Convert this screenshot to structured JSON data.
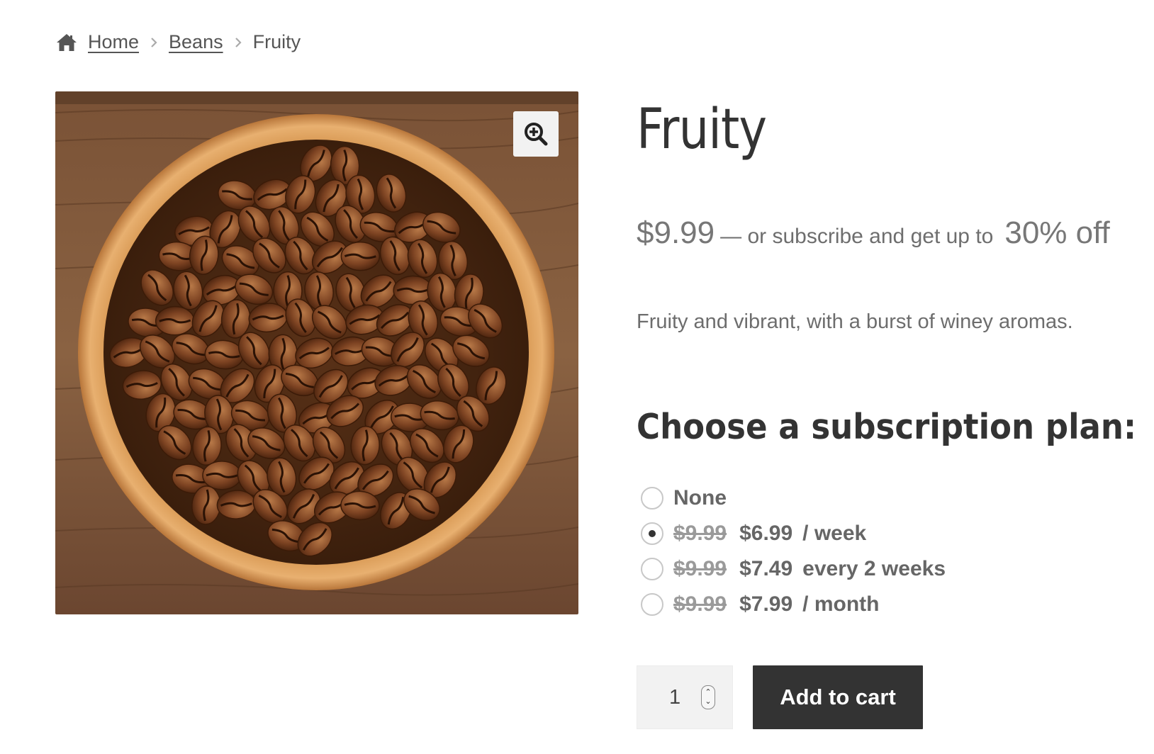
{
  "breadcrumb": {
    "items": [
      {
        "label": "Home"
      },
      {
        "label": "Beans"
      }
    ],
    "current": "Fruity"
  },
  "product": {
    "title": "Fruity",
    "price": "$9.99",
    "price_details": "— or subscribe and get up to",
    "discount": "30% off",
    "description": "Fruity and vibrant, with a burst of winey aromas."
  },
  "subscription": {
    "heading": "Choose a subscription plan:",
    "selected_index": 1,
    "options": [
      {
        "label": "None",
        "old_price": "",
        "new_price": "",
        "period": ""
      },
      {
        "label": "",
        "old_price": "$9.99",
        "new_price": "$6.99",
        "period": "/ week"
      },
      {
        "label": "",
        "old_price": "$9.99",
        "new_price": "$7.49",
        "period": "every 2 weeks"
      },
      {
        "label": "",
        "old_price": "$9.99",
        "new_price": "$7.99",
        "period": "/ month"
      }
    ]
  },
  "cart": {
    "quantity": "1",
    "add_label": "Add to cart"
  },
  "icons": {
    "home": "home-icon",
    "zoom": "zoom-in-icon",
    "separator": "chevron-right-icon"
  },
  "colors": {
    "button_bg": "#333333",
    "text": "#333333",
    "muted": "#6d6d6d"
  }
}
